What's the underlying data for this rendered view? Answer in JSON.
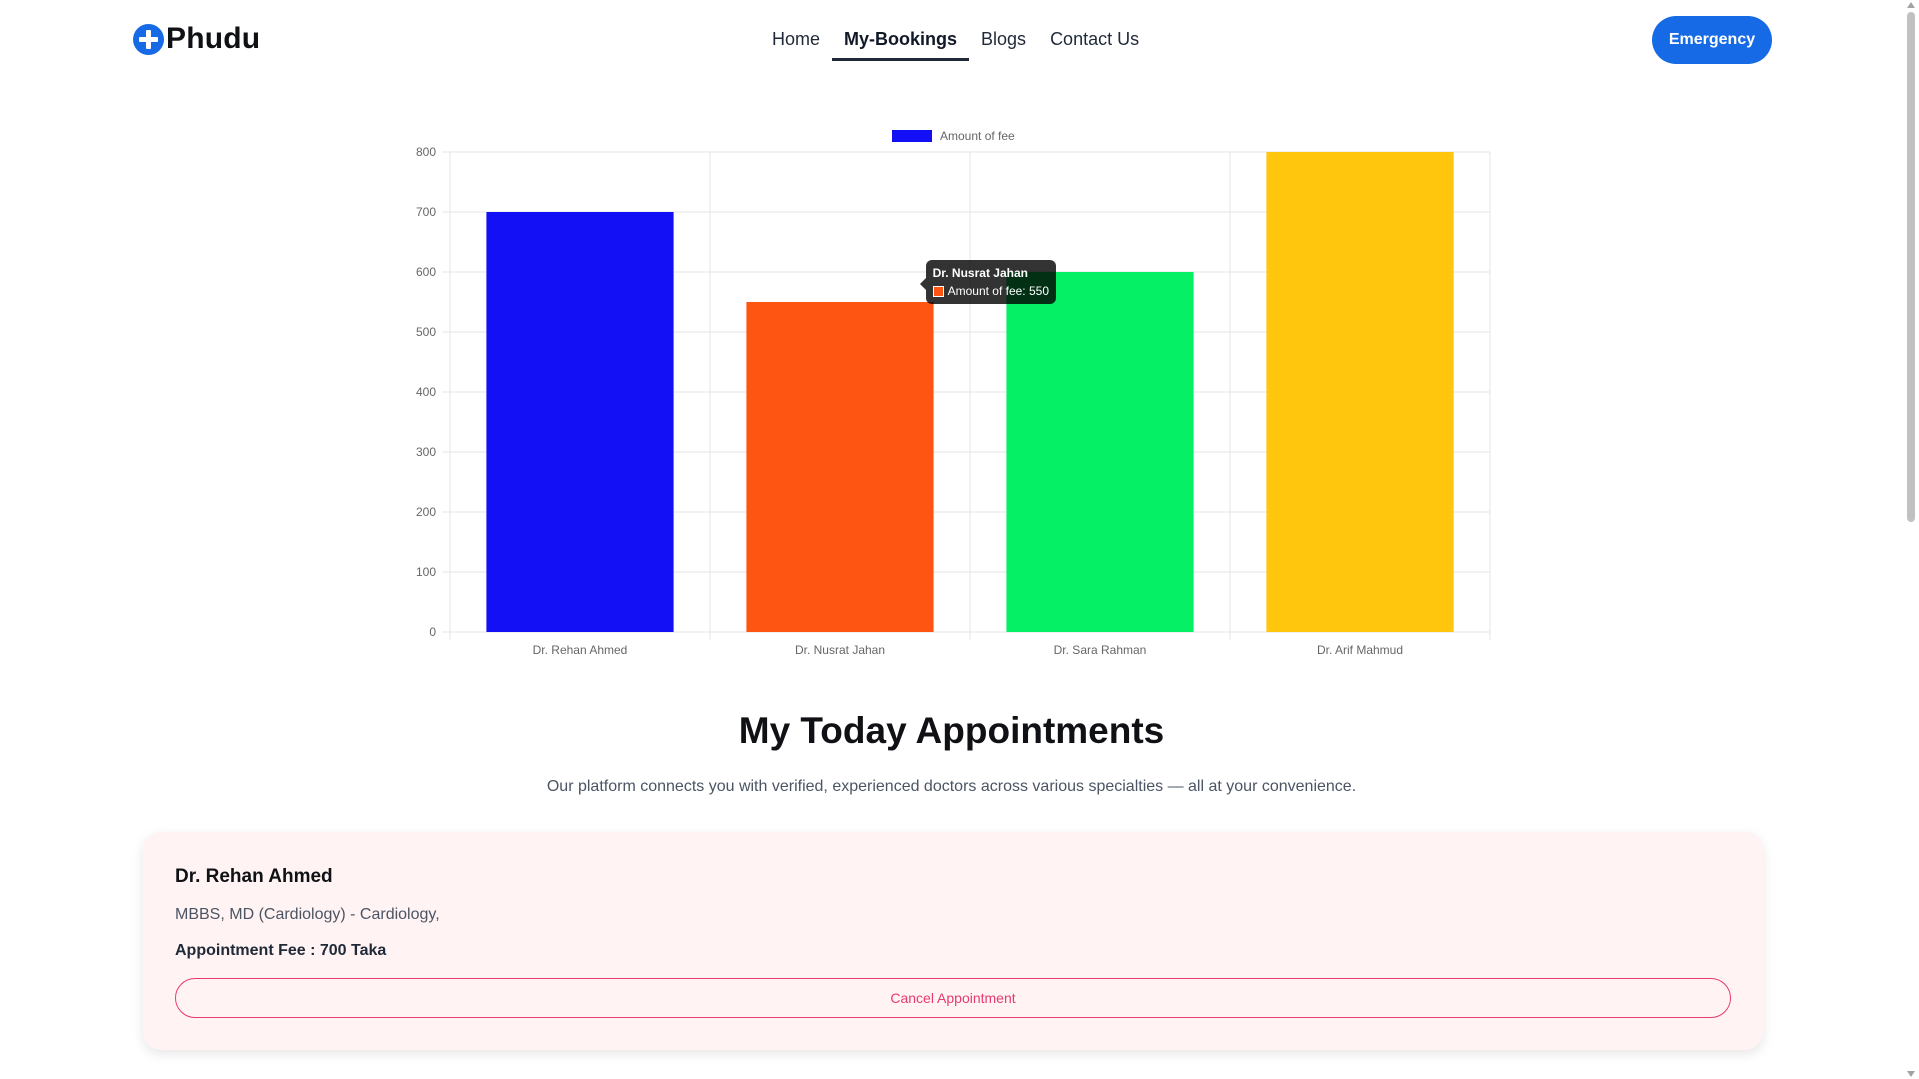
{
  "brand": {
    "name": "Phudu",
    "icon": "plus-circle-icon",
    "color": "#176AE5"
  },
  "nav": {
    "items": [
      {
        "label": "Home",
        "active": false
      },
      {
        "label": "My-Bookings",
        "active": true
      },
      {
        "label": "Blogs",
        "active": false
      },
      {
        "label": "Contact Us",
        "active": false
      }
    ],
    "emergency_label": "Emergency"
  },
  "chart_data": {
    "type": "bar",
    "categories": [
      "Dr. Rehan Ahmed",
      "Dr. Nusrat Jahan",
      "Dr. Sara Rahman",
      "Dr. Arif Mahmud"
    ],
    "series": [
      {
        "name": "Amount of fee",
        "values": [
          700,
          550,
          600,
          800
        ]
      }
    ],
    "bar_colors": [
      "#1410F5",
      "#FF5512",
      "#05F065",
      "#FFC60D"
    ],
    "legend_color": "#1410F5",
    "ylim": [
      0,
      800
    ],
    "yticks": [
      0,
      100,
      200,
      300,
      400,
      500,
      600,
      700,
      800
    ],
    "grid": true,
    "legend_position": "top",
    "tooltip": {
      "title": "Dr. Nusrat Jahan",
      "label": "Amount of fee: 550",
      "swatch_color": "#FF5512"
    }
  },
  "section": {
    "title": "My Today Appointments",
    "subtitle": "Our platform connects you with verified, experienced doctors across various specialties — all at your convenience."
  },
  "appointments": [
    {
      "doctor": "Dr. Rehan Ahmed",
      "degree": "MBBS, MD (Cardiology) - Cardiology,",
      "fee": "Appointment Fee : 700 Taka",
      "cancel_label": "Cancel Appointment"
    }
  ],
  "colors": {
    "accent": "#176AE5",
    "cancel": "#E83B6E",
    "card_bg": "#FFF3F4"
  }
}
